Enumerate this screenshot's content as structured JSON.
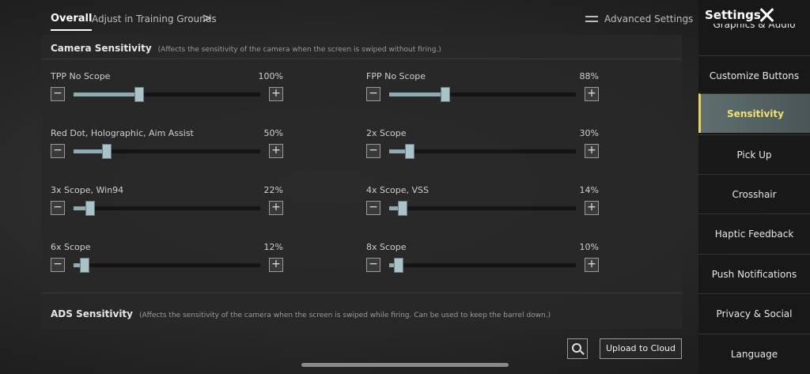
{
  "header": {
    "tabs": [
      {
        "label": "Overall",
        "active": true
      },
      {
        "label": "Adjust in Training Grounds"
      }
    ],
    "chevron": ">",
    "advanced_settings_label": "Advanced Settings"
  },
  "camera_sensitivity": {
    "title": "Camera Sensitivity",
    "note": "(Affects the sensitivity of the camera when the screen is swiped without firing.)",
    "sliders": [
      {
        "label": "TPP No Scope",
        "value": "100%",
        "level": 0.35
      },
      {
        "label": "FPP No Scope",
        "value": "88%",
        "level": 0.3
      },
      {
        "label": "Red Dot, Holographic, Aim Assist",
        "value": "50%",
        "level": 0.18
      },
      {
        "label": "2x Scope",
        "value": "30%",
        "level": 0.11
      },
      {
        "label": "3x Scope, Win94",
        "value": "22%",
        "level": 0.09
      },
      {
        "label": "4x Scope, VSS",
        "value": "14%",
        "level": 0.07
      },
      {
        "label": "6x Scope",
        "value": "12%",
        "level": 0.06
      },
      {
        "label": "8x Scope",
        "value": "10%",
        "level": 0.05
      }
    ],
    "minus_symbol": "−",
    "plus_symbol": "+"
  },
  "ads_sensitivity": {
    "title": "ADS Sensitivity",
    "note": "(Affects the sensitivity of the camera when the screen is swiped while firing. Can be used to keep the barrel down.)"
  },
  "actions": {
    "upload_label": "Upload to Cloud",
    "search_icon": "search-icon"
  },
  "sidebar": {
    "title": "Settings",
    "items": [
      {
        "label": "Graphics & Audio"
      },
      {
        "label": "Customize Buttons"
      },
      {
        "label": "Sensitivity",
        "active": true
      },
      {
        "label": "Pick Up"
      },
      {
        "label": "Crosshair"
      },
      {
        "label": "Haptic Feedback"
      },
      {
        "label": "Push Notifications"
      },
      {
        "label": "Privacy & Social"
      },
      {
        "label": "Language"
      }
    ]
  },
  "colors": {
    "active_text": "#f3e16a",
    "slider_fill": "#8faab0",
    "slider_thumb": "#aac3c8"
  }
}
